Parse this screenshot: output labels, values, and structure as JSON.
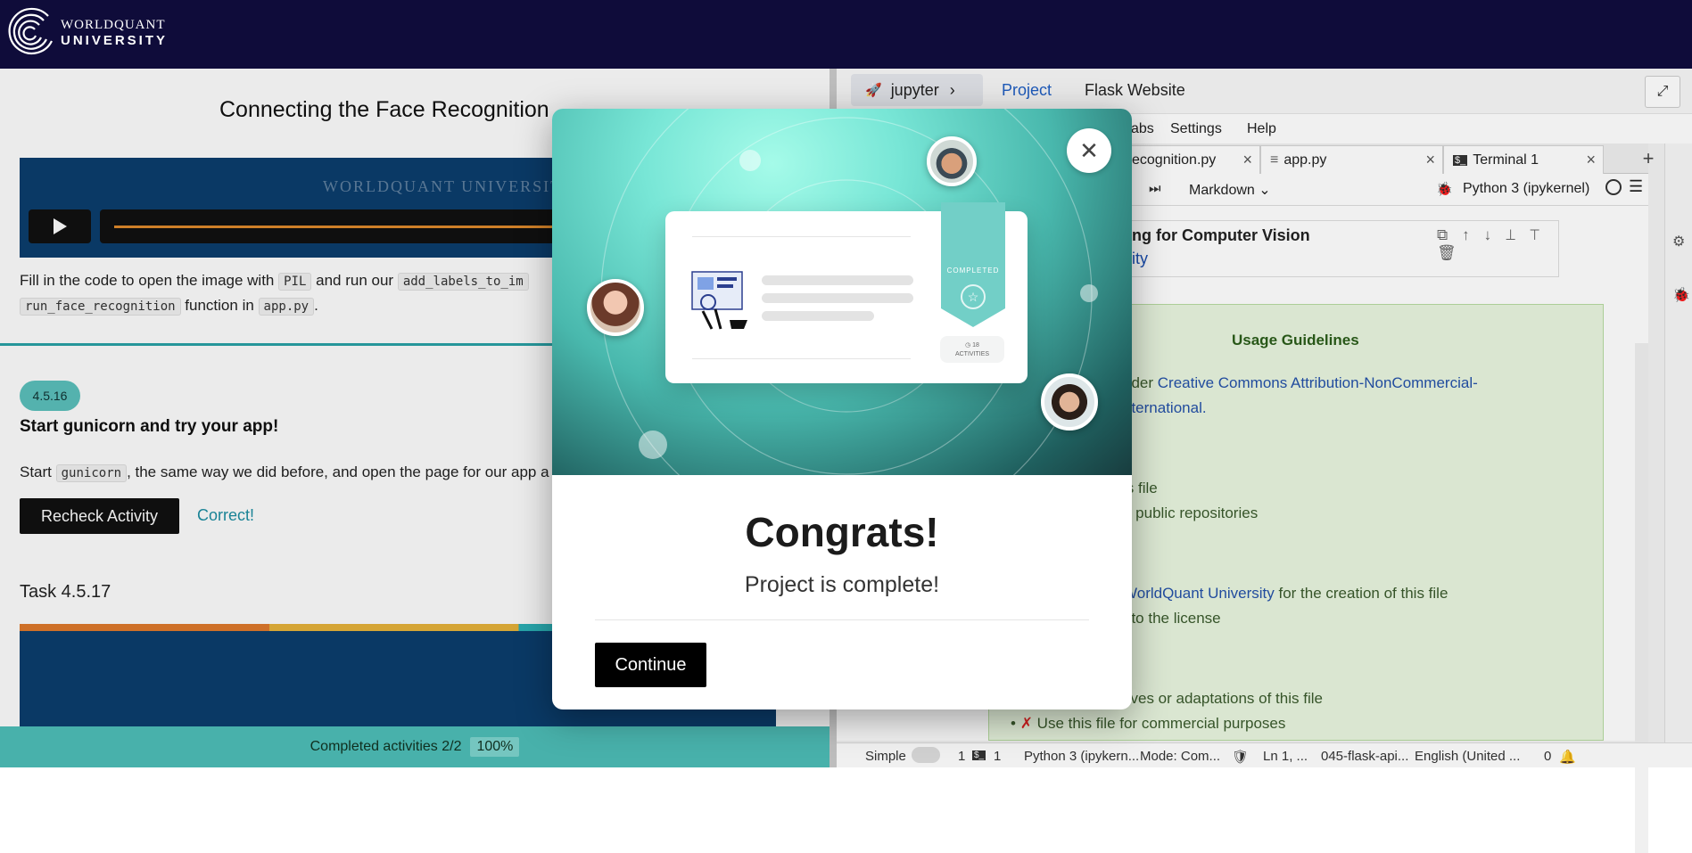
{
  "brand": {
    "line1": "WORLDQUANT",
    "line2": "UNIVERSITY"
  },
  "lesson": {
    "title": "Connecting the Face Recognition",
    "video_watermark": "WORLDQUANT UNIVERSITY",
    "para1_a": "Fill in the code to open the image with ",
    "code_pil": "PIL",
    "para1_b": " and run our ",
    "code_addlabels": "add_labels_to_im",
    "code_runface": "run_face_recognition",
    "para2_b": " function in ",
    "code_app": "app.py",
    "para2_c": ".",
    "task_badge": "4.5.16",
    "task_heading": "Start gunicorn and try your app!",
    "para3_a": "Start ",
    "code_gunicorn": "gunicorn",
    "para3_b": ", the same way we did before, and open the page for our app a",
    "recheck_label": "Recheck Activity",
    "correct_label": "Correct!",
    "next_task": "Task 4.5.17"
  },
  "progress": {
    "label": "Completed activities 2/2",
    "percent_text": "100%",
    "percent": 100
  },
  "ide": {
    "project_tabs": [
      {
        "label": "jupyter"
      },
      {
        "label": "Project"
      },
      {
        "label": "Flask Website"
      }
    ],
    "menus": [
      "abs",
      "Settings",
      "Help"
    ],
    "file_tabs": [
      {
        "label": "ecognition.py"
      },
      {
        "label": "app.py"
      },
      {
        "label": "Terminal 1"
      }
    ],
    "cell_type": "Markdown",
    "kernel": "Python 3 (ipykernel)",
    "heading_bold": "ng for Computer Vision",
    "heading_link": "ity",
    "usage": {
      "title": "Usage Guidelines",
      "line1_a": "nder ",
      "line1_link": "Creative Commons Attribution-NonCommercial-",
      "line2_link": "nternational.",
      "line3": "is file",
      "line4": "n public repositories",
      "line5_link": "WorldQuant University",
      "line5_b": " for the creation of this file",
      "line6": "t to the license",
      "line7": "tives or adaptations of this file",
      "bullet": "✗",
      "line8": "Use this file for commercial purposes"
    },
    "status": {
      "mode": "Simple",
      "count1": "1",
      "count2": "1",
      "kernel": "Python 3 (ipykern...",
      "edit_mode": "Mode: Com...",
      "cursor": "Ln 1, ...",
      "file": "045-flask-api...",
      "lang": "English (United ...",
      "notif": "0"
    }
  },
  "modal": {
    "card_ribbon_label": "COMPLETED",
    "card_activities": "18",
    "card_activities_label": "ACTIVITIES",
    "heading": "Congrats!",
    "subheading": "Project is complete!",
    "continue_label": "Continue"
  }
}
